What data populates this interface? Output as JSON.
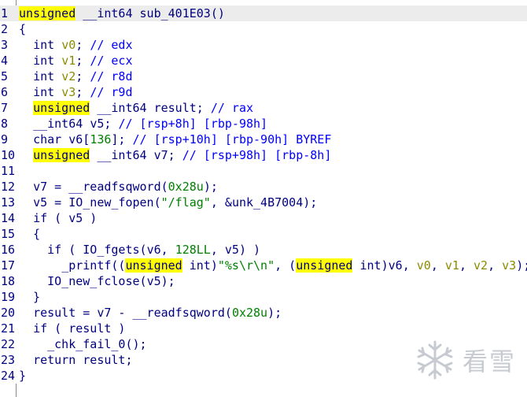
{
  "lines": [
    {
      "n": "1",
      "t": "unsigned __int64 sub_401E03()"
    },
    {
      "n": "2",
      "t": "{"
    },
    {
      "n": "3",
      "t": "  int v0; // edx"
    },
    {
      "n": "4",
      "t": "  int v1; // ecx"
    },
    {
      "n": "5",
      "t": "  int v2; // r8d"
    },
    {
      "n": "6",
      "t": "  int v3; // r9d"
    },
    {
      "n": "7",
      "t": "  unsigned __int64 result; // rax"
    },
    {
      "n": "8",
      "t": "  __int64 v5; // [rsp+8h] [rbp-98h]"
    },
    {
      "n": "9",
      "t": "  char v6[136]; // [rsp+10h] [rbp-90h] BYREF"
    },
    {
      "n": "10",
      "t": "  unsigned __int64 v7; // [rsp+98h] [rbp-8h]"
    },
    {
      "n": "11",
      "t": ""
    },
    {
      "n": "12",
      "t": "  v7 = __readfsqword(0x28u);"
    },
    {
      "n": "13",
      "t": "  v5 = IO_new_fopen(\"/flag\", &unk_4B7004);"
    },
    {
      "n": "14",
      "t": "  if ( v5 )"
    },
    {
      "n": "15",
      "t": "  {"
    },
    {
      "n": "16",
      "t": "    if ( IO_fgets(v6, 128LL, v5) )"
    },
    {
      "n": "17",
      "t": "      _printf((unsigned int)\"%s\\r\\n\", (unsigned int)v6, v0, v1, v2, v3);"
    },
    {
      "n": "18",
      "t": "    IO_new_fclose(v5);"
    },
    {
      "n": "19",
      "t": "  }"
    },
    {
      "n": "20",
      "t": "  result = v7 - __readfsqword(0x28u);"
    },
    {
      "n": "21",
      "t": "  if ( result )"
    },
    {
      "n": "22",
      "t": "    _chk_fail_0();"
    },
    {
      "n": "23",
      "t": "  return result;"
    },
    {
      "n": "24",
      "t": "}"
    }
  ],
  "watermark": {
    "text": "看雪",
    "icon": "snowflake-icon"
  },
  "colors": {
    "keyword": "#000080",
    "highlight": "#ffff00",
    "comment": "#0000ff",
    "string": "#008000",
    "gutter_text": "#000080"
  }
}
